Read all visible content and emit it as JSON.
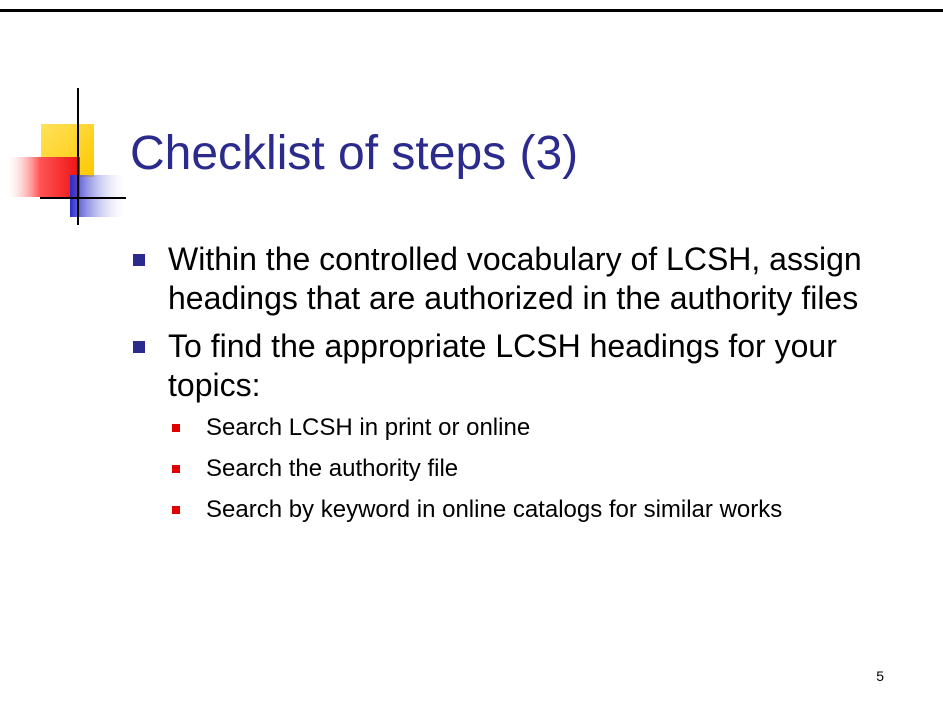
{
  "slide": {
    "title": "Checklist of steps (3)",
    "page_number": "5",
    "colors": {
      "title": "#2b2b8e",
      "bullet_level1": "#2b2b8e",
      "bullet_level2": "#e00000",
      "deco_yellow": "#ffd21c",
      "deco_red": "#ff3333",
      "deco_blue": "#3a3ad8"
    },
    "bullets": [
      {
        "text": "Within the controlled vocabulary of LCSH, assign headings that are authorized in the authority files"
      },
      {
        "text": "To find the appropriate LCSH headings for your topics:",
        "sub_bullets": [
          {
            "text": "Search LCSH in print or online"
          },
          {
            "text": "Search the authority file"
          },
          {
            "text": "Search by keyword in online catalogs for similar works"
          }
        ]
      }
    ]
  }
}
